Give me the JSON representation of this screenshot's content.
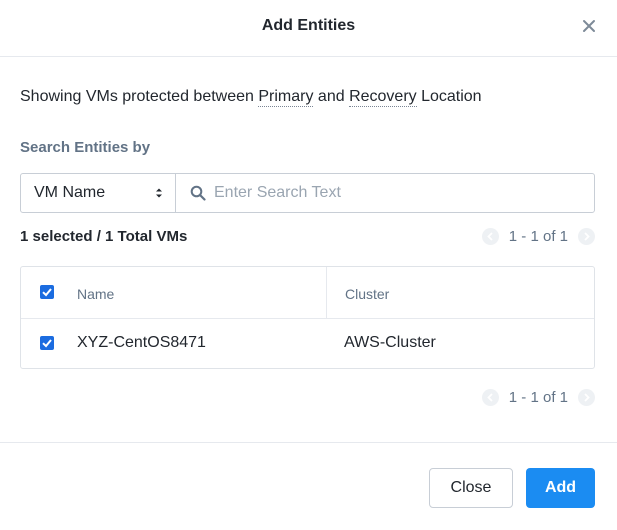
{
  "dialog": {
    "title": "Add Entities",
    "close_icon": "close-icon"
  },
  "description": {
    "prefix": "Showing VMs protected between ",
    "primary": "Primary",
    "and": " and ",
    "recovery": "Recovery",
    "suffix": " Location"
  },
  "search": {
    "label": "Search Entities by",
    "field_select": "VM Name",
    "placeholder": "Enter Search Text",
    "value": ""
  },
  "summary": {
    "count_text": "1 selected / 1 Total VMs"
  },
  "pagination_top": {
    "text": "1 - 1 of 1"
  },
  "pagination_bottom": {
    "text": "1 - 1 of 1"
  },
  "table": {
    "columns": [
      "Name",
      "Cluster"
    ],
    "header_checked": true,
    "rows": [
      {
        "checked": true,
        "name": "XYZ-CentOS8471",
        "cluster": "AWS-Cluster"
      }
    ]
  },
  "buttons": {
    "close": "Close",
    "add": "Add"
  },
  "colors": {
    "primary_blue": "#1b8cf2",
    "checkbox_blue": "#1b6ce0",
    "label_gray": "#627386"
  }
}
